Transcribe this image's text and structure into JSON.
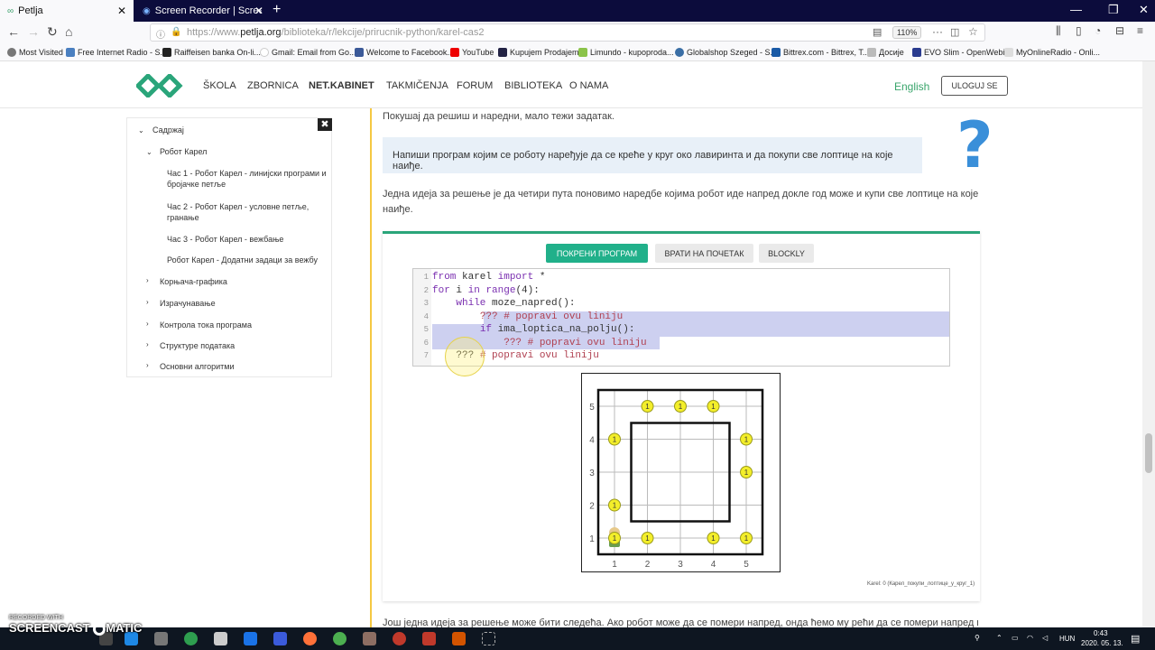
{
  "browser": {
    "tabs": [
      {
        "title": "Petlja"
      },
      {
        "title": "Screen Recorder | Screencast-O"
      }
    ],
    "url_prefix": "https://www.",
    "url_domain": "petlja.org",
    "url_path": "/biblioteka/r/lekcije/prirucnik-python/karel-cas2",
    "zoom": "110%",
    "bookmarks": [
      "Most Visited",
      "Free Internet Radio - S...",
      "Raiffeisen banka On-li...",
      "Gmail: Email from Go...",
      "Welcome to Facebook...",
      "YouTube",
      "Kupujem Prodajem",
      "Limundo - kupoproda...",
      "Globalshop Szeged - S...",
      "Bittrex.com - Bittrex, T...",
      "Досије",
      "EVO Slim - OpenWebif",
      "MyOnlineRadio - Onli..."
    ]
  },
  "site": {
    "nav": [
      "ŠKOLA",
      "ZBORNICA",
      "NET.KABINET",
      "TAKMIČENJA",
      "FORUM",
      "BIBLIOTEKA",
      "O NAMA"
    ],
    "language": "English",
    "login": "ULOGUJ SE"
  },
  "sidebar": {
    "close": "✖",
    "heading": "Садржај",
    "group": "Робот Карел",
    "lessons": [
      "Час 1 - Робот Карел - линијски програми и бројачке петље",
      "Час 2 - Робот Карел - условне петље, гранање",
      "Час 3 - Робот Карел - вежбање",
      "Робот Карел - Додатни задаци за вежбу"
    ],
    "sections": [
      "Корњача-графика",
      "Израчунавање",
      "Контрола тока програма",
      "Структуре података",
      "Основни алгоритми"
    ]
  },
  "content": {
    "intro": "Покушај да решиш и наредни, мало тежи задатак.",
    "task": "Напиши програм којим се роботу наређује да се креће у круг око лавиринта и да покупи све лоптице на које наиђе.",
    "idea_line1": "Једна идеја за решење је да четири пута поновимо наредбе којима робот иде напред докле год може и купи све лоптице на које",
    "idea_line2": "наиђе.",
    "buttons": {
      "run": "ПОКРЕНИ ПРОГРАМ",
      "reset": "ВРАТИ НА ПОЧЕТАК",
      "blockly": "BLOCKLY"
    },
    "caption": "Karel: 0 (Карел_покупи_лоптице_у_круг_1)",
    "bottom": "Још једна идеја за решење може бити следећа. Ако робот може да се помери напред, онда ћемо му рећи да се помери напред и"
  },
  "code_lines": [
    {
      "n": "1",
      "parts": [
        [
          "kw",
          "from"
        ],
        [
          "",
          " karel "
        ],
        [
          "kw",
          "import"
        ],
        [
          "",
          " *"
        ]
      ]
    },
    {
      "n": "2",
      "parts": [
        [
          "kw",
          "for"
        ],
        [
          "",
          " i "
        ],
        [
          "kw",
          "in"
        ],
        [
          "",
          " "
        ],
        [
          "kw",
          "range"
        ],
        [
          "",
          "(4):"
        ]
      ]
    },
    {
      "n": "3",
      "parts": [
        [
          "",
          "    "
        ],
        [
          "kw",
          "while"
        ],
        [
          "",
          " moze_napred():"
        ]
      ]
    },
    {
      "n": "4",
      "parts": [
        [
          "",
          "        "
        ],
        [
          "cm",
          "??? # popravi ovu liniju"
        ]
      ]
    },
    {
      "n": "5",
      "parts": [
        [
          "",
          "        "
        ],
        [
          "kw",
          "if"
        ],
        [
          "",
          " ima_loptica_na_polju():"
        ]
      ]
    },
    {
      "n": "6",
      "parts": [
        [
          "",
          "            "
        ],
        [
          "cm",
          "??? # popravi ovu liniju"
        ]
      ]
    },
    {
      "n": "7",
      "parts": [
        [
          "",
          "    "
        ],
        [
          "",
          "??? "
        ],
        [
          "cm",
          "# popravi ovu liniju"
        ]
      ]
    }
  ],
  "karel_world": {
    "x_ticks": [
      "1",
      "2",
      "3",
      "4",
      "5"
    ],
    "y_ticks": [
      "1",
      "2",
      "3",
      "4",
      "5"
    ],
    "balls": [
      [
        2,
        5
      ],
      [
        3,
        5
      ],
      [
        4,
        5
      ],
      [
        1,
        4
      ],
      [
        5,
        4
      ],
      [
        5,
        3
      ],
      [
        1,
        2
      ],
      [
        2,
        1
      ],
      [
        4,
        1
      ],
      [
        5,
        1
      ],
      [
        1,
        1
      ]
    ],
    "ball_label": "1",
    "robot": [
      1,
      1
    ]
  },
  "taskbar": {
    "lang": "HUN",
    "time": "0:43",
    "date": "2020. 05. 13.",
    "watermark_top": "RECORDED WITH",
    "watermark_main": "SCREENCAST",
    "watermark_tail": "MATIC"
  }
}
